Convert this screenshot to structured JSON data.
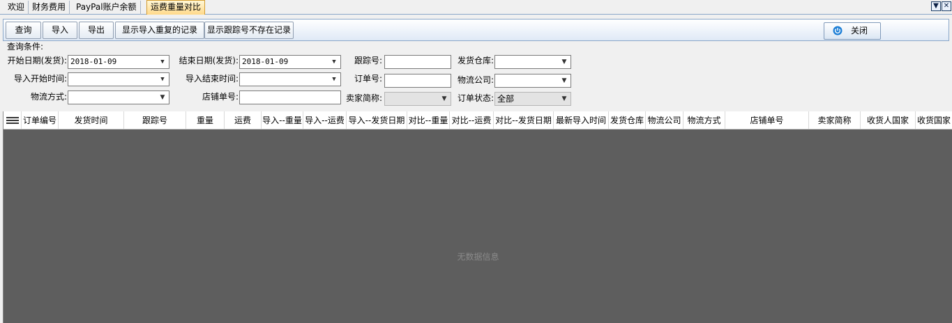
{
  "tabs": [
    {
      "label": "欢迎"
    },
    {
      "label": "财务费用"
    },
    {
      "label": "PayPal账户余额"
    },
    {
      "label": "运费重量对比"
    }
  ],
  "window_controls": {
    "dropdown": "▼",
    "close": "✕"
  },
  "toolbar": {
    "query": "查询",
    "import": "导入",
    "export": "导出",
    "show_duplicates": "显示导入重复的记录",
    "show_missing_tracking": "显示跟踪号不存在记录",
    "close": "关闭"
  },
  "query": {
    "legend": "查询条件:",
    "start_date_label": "开始日期(发货):",
    "start_date_value": "2018-01-09",
    "end_date_label": "结束日期(发货):",
    "end_date_value": "2018-01-09",
    "tracking_label": "跟踪号:",
    "tracking_value": "",
    "warehouse_label": "发货仓库:",
    "warehouse_value": "",
    "import_start_label": "导入开始时间:",
    "import_start_value": "  -  -       :  :",
    "import_end_label": "导入结束时间:",
    "import_end_value": "  -  -       :  :",
    "order_no_label": "订单号:",
    "order_no_value": "",
    "logistics_company_label": "物流公司:",
    "logistics_company_value": "",
    "logistics_method_label": "物流方式:",
    "logistics_method_value": "",
    "store_order_label": "店铺单号:",
    "store_order_value": "",
    "seller_label": "卖家简称:",
    "seller_value": "",
    "order_status_label": "订单状态:",
    "order_status_value": "全部"
  },
  "grid": {
    "columns": [
      "订单编号",
      "发货时间",
      "跟踪号",
      "重量",
      "运费",
      "导入--重量",
      "导入--运费",
      "导入--发货日期",
      "对比--重量",
      "对比--运费",
      "对比--发货日期",
      "最新导入时间",
      "发货仓库",
      "物流公司",
      "物流方式",
      "店铺单号",
      "卖家简称",
      "收货人国家",
      "收货国家"
    ],
    "empty_message": "无数据信息"
  }
}
